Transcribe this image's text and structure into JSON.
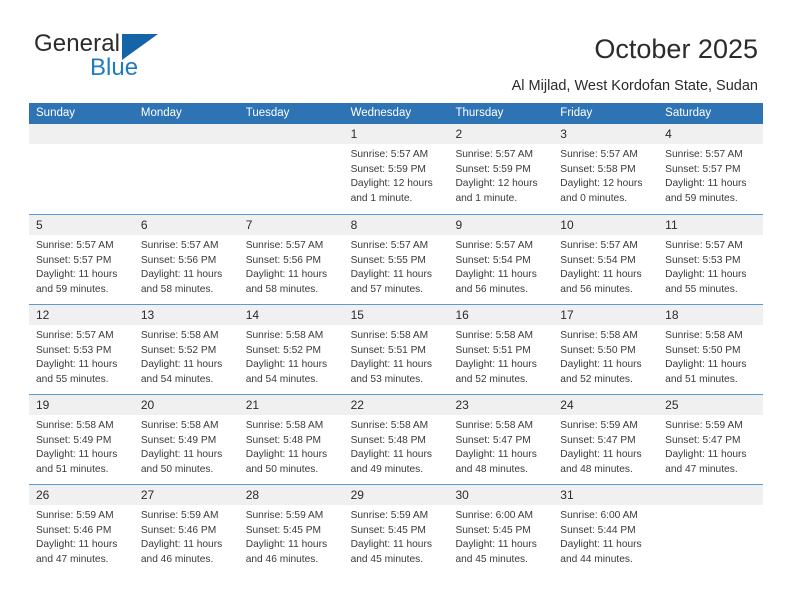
{
  "brand": {
    "name_part1": "General",
    "name_part2": "Blue"
  },
  "header": {
    "title": "October 2025",
    "subtitle": "Al Mijlad, West Kordofan State, Sudan"
  },
  "colors": {
    "header_blue": "#2e74b5",
    "row_divider": "#5b9bd5",
    "daynum_bg": "#f0f0f0",
    "brand_blue": "#1f7bc1",
    "text": "#2b2b2b"
  },
  "calendar": {
    "day_headers": [
      "Sunday",
      "Monday",
      "Tuesday",
      "Wednesday",
      "Thursday",
      "Friday",
      "Saturday"
    ],
    "weeks": [
      [
        {
          "day": "",
          "sunrise": "",
          "sunset": "",
          "daylight_line1": "",
          "daylight_line2": "",
          "empty": true
        },
        {
          "day": "",
          "sunrise": "",
          "sunset": "",
          "daylight_line1": "",
          "daylight_line2": "",
          "empty": true
        },
        {
          "day": "",
          "sunrise": "",
          "sunset": "",
          "daylight_line1": "",
          "daylight_line2": "",
          "empty": true
        },
        {
          "day": "1",
          "sunrise": "Sunrise: 5:57 AM",
          "sunset": "Sunset: 5:59 PM",
          "daylight_line1": "Daylight: 12 hours",
          "daylight_line2": "and 1 minute.",
          "empty": false
        },
        {
          "day": "2",
          "sunrise": "Sunrise: 5:57 AM",
          "sunset": "Sunset: 5:59 PM",
          "daylight_line1": "Daylight: 12 hours",
          "daylight_line2": "and 1 minute.",
          "empty": false
        },
        {
          "day": "3",
          "sunrise": "Sunrise: 5:57 AM",
          "sunset": "Sunset: 5:58 PM",
          "daylight_line1": "Daylight: 12 hours",
          "daylight_line2": "and 0 minutes.",
          "empty": false
        },
        {
          "day": "4",
          "sunrise": "Sunrise: 5:57 AM",
          "sunset": "Sunset: 5:57 PM",
          "daylight_line1": "Daylight: 11 hours",
          "daylight_line2": "and 59 minutes.",
          "empty": false
        }
      ],
      [
        {
          "day": "5",
          "sunrise": "Sunrise: 5:57 AM",
          "sunset": "Sunset: 5:57 PM",
          "daylight_line1": "Daylight: 11 hours",
          "daylight_line2": "and 59 minutes.",
          "empty": false
        },
        {
          "day": "6",
          "sunrise": "Sunrise: 5:57 AM",
          "sunset": "Sunset: 5:56 PM",
          "daylight_line1": "Daylight: 11 hours",
          "daylight_line2": "and 58 minutes.",
          "empty": false
        },
        {
          "day": "7",
          "sunrise": "Sunrise: 5:57 AM",
          "sunset": "Sunset: 5:56 PM",
          "daylight_line1": "Daylight: 11 hours",
          "daylight_line2": "and 58 minutes.",
          "empty": false
        },
        {
          "day": "8",
          "sunrise": "Sunrise: 5:57 AM",
          "sunset": "Sunset: 5:55 PM",
          "daylight_line1": "Daylight: 11 hours",
          "daylight_line2": "and 57 minutes.",
          "empty": false
        },
        {
          "day": "9",
          "sunrise": "Sunrise: 5:57 AM",
          "sunset": "Sunset: 5:54 PM",
          "daylight_line1": "Daylight: 11 hours",
          "daylight_line2": "and 56 minutes.",
          "empty": false
        },
        {
          "day": "10",
          "sunrise": "Sunrise: 5:57 AM",
          "sunset": "Sunset: 5:54 PM",
          "daylight_line1": "Daylight: 11 hours",
          "daylight_line2": "and 56 minutes.",
          "empty": false
        },
        {
          "day": "11",
          "sunrise": "Sunrise: 5:57 AM",
          "sunset": "Sunset: 5:53 PM",
          "daylight_line1": "Daylight: 11 hours",
          "daylight_line2": "and 55 minutes.",
          "empty": false
        }
      ],
      [
        {
          "day": "12",
          "sunrise": "Sunrise: 5:57 AM",
          "sunset": "Sunset: 5:53 PM",
          "daylight_line1": "Daylight: 11 hours",
          "daylight_line2": "and 55 minutes.",
          "empty": false
        },
        {
          "day": "13",
          "sunrise": "Sunrise: 5:58 AM",
          "sunset": "Sunset: 5:52 PM",
          "daylight_line1": "Daylight: 11 hours",
          "daylight_line2": "and 54 minutes.",
          "empty": false
        },
        {
          "day": "14",
          "sunrise": "Sunrise: 5:58 AM",
          "sunset": "Sunset: 5:52 PM",
          "daylight_line1": "Daylight: 11 hours",
          "daylight_line2": "and 54 minutes.",
          "empty": false
        },
        {
          "day": "15",
          "sunrise": "Sunrise: 5:58 AM",
          "sunset": "Sunset: 5:51 PM",
          "daylight_line1": "Daylight: 11 hours",
          "daylight_line2": "and 53 minutes.",
          "empty": false
        },
        {
          "day": "16",
          "sunrise": "Sunrise: 5:58 AM",
          "sunset": "Sunset: 5:51 PM",
          "daylight_line1": "Daylight: 11 hours",
          "daylight_line2": "and 52 minutes.",
          "empty": false
        },
        {
          "day": "17",
          "sunrise": "Sunrise: 5:58 AM",
          "sunset": "Sunset: 5:50 PM",
          "daylight_line1": "Daylight: 11 hours",
          "daylight_line2": "and 52 minutes.",
          "empty": false
        },
        {
          "day": "18",
          "sunrise": "Sunrise: 5:58 AM",
          "sunset": "Sunset: 5:50 PM",
          "daylight_line1": "Daylight: 11 hours",
          "daylight_line2": "and 51 minutes.",
          "empty": false
        }
      ],
      [
        {
          "day": "19",
          "sunrise": "Sunrise: 5:58 AM",
          "sunset": "Sunset: 5:49 PM",
          "daylight_line1": "Daylight: 11 hours",
          "daylight_line2": "and 51 minutes.",
          "empty": false
        },
        {
          "day": "20",
          "sunrise": "Sunrise: 5:58 AM",
          "sunset": "Sunset: 5:49 PM",
          "daylight_line1": "Daylight: 11 hours",
          "daylight_line2": "and 50 minutes.",
          "empty": false
        },
        {
          "day": "21",
          "sunrise": "Sunrise: 5:58 AM",
          "sunset": "Sunset: 5:48 PM",
          "daylight_line1": "Daylight: 11 hours",
          "daylight_line2": "and 50 minutes.",
          "empty": false
        },
        {
          "day": "22",
          "sunrise": "Sunrise: 5:58 AM",
          "sunset": "Sunset: 5:48 PM",
          "daylight_line1": "Daylight: 11 hours",
          "daylight_line2": "and 49 minutes.",
          "empty": false
        },
        {
          "day": "23",
          "sunrise": "Sunrise: 5:58 AM",
          "sunset": "Sunset: 5:47 PM",
          "daylight_line1": "Daylight: 11 hours",
          "daylight_line2": "and 48 minutes.",
          "empty": false
        },
        {
          "day": "24",
          "sunrise": "Sunrise: 5:59 AM",
          "sunset": "Sunset: 5:47 PM",
          "daylight_line1": "Daylight: 11 hours",
          "daylight_line2": "and 48 minutes.",
          "empty": false
        },
        {
          "day": "25",
          "sunrise": "Sunrise: 5:59 AM",
          "sunset": "Sunset: 5:47 PM",
          "daylight_line1": "Daylight: 11 hours",
          "daylight_line2": "and 47 minutes.",
          "empty": false
        }
      ],
      [
        {
          "day": "26",
          "sunrise": "Sunrise: 5:59 AM",
          "sunset": "Sunset: 5:46 PM",
          "daylight_line1": "Daylight: 11 hours",
          "daylight_line2": "and 47 minutes.",
          "empty": false
        },
        {
          "day": "27",
          "sunrise": "Sunrise: 5:59 AM",
          "sunset": "Sunset: 5:46 PM",
          "daylight_line1": "Daylight: 11 hours",
          "daylight_line2": "and 46 minutes.",
          "empty": false
        },
        {
          "day": "28",
          "sunrise": "Sunrise: 5:59 AM",
          "sunset": "Sunset: 5:45 PM",
          "daylight_line1": "Daylight: 11 hours",
          "daylight_line2": "and 46 minutes.",
          "empty": false
        },
        {
          "day": "29",
          "sunrise": "Sunrise: 5:59 AM",
          "sunset": "Sunset: 5:45 PM",
          "daylight_line1": "Daylight: 11 hours",
          "daylight_line2": "and 45 minutes.",
          "empty": false
        },
        {
          "day": "30",
          "sunrise": "Sunrise: 6:00 AM",
          "sunset": "Sunset: 5:45 PM",
          "daylight_line1": "Daylight: 11 hours",
          "daylight_line2": "and 45 minutes.",
          "empty": false
        },
        {
          "day": "31",
          "sunrise": "Sunrise: 6:00 AM",
          "sunset": "Sunset: 5:44 PM",
          "daylight_line1": "Daylight: 11 hours",
          "daylight_line2": "and 44 minutes.",
          "empty": false
        },
        {
          "day": "",
          "sunrise": "",
          "sunset": "",
          "daylight_line1": "",
          "daylight_line2": "",
          "empty": true
        }
      ]
    ]
  }
}
